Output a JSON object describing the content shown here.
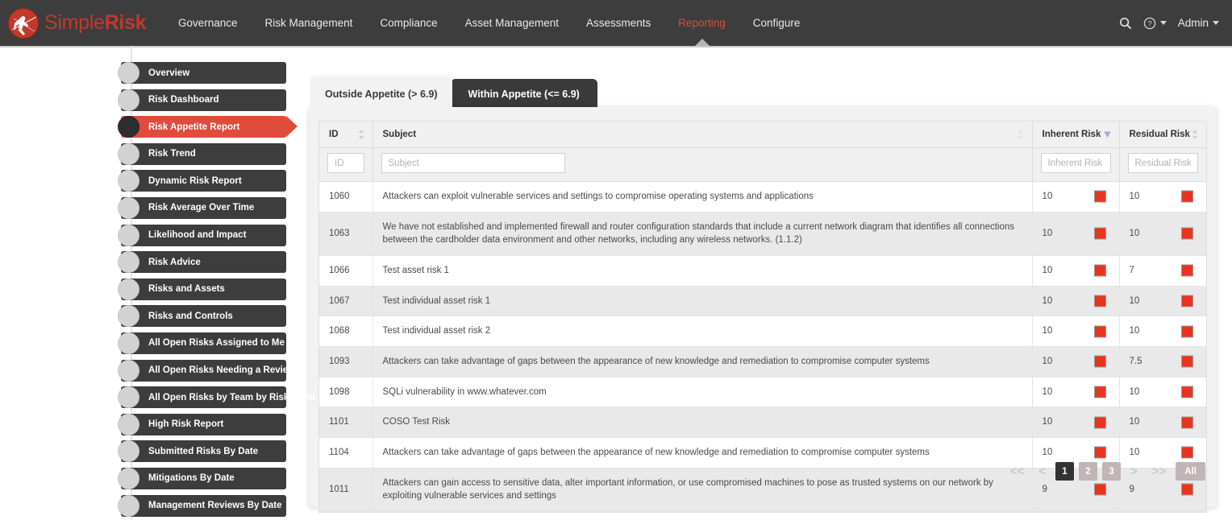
{
  "brand": {
    "part1": "Simple",
    "part2": "Risk",
    "logo_icon": "simplerisk-logo-icon"
  },
  "topnav": {
    "items": [
      {
        "label": "Governance",
        "active": false
      },
      {
        "label": "Risk Management",
        "active": false
      },
      {
        "label": "Compliance",
        "active": false
      },
      {
        "label": "Asset Management",
        "active": false
      },
      {
        "label": "Assessments",
        "active": false
      },
      {
        "label": "Reporting",
        "active": true
      },
      {
        "label": "Configure",
        "active": false
      }
    ],
    "search_icon": "search-icon",
    "help_icon": "help-circle-icon",
    "user_label": "Admin"
  },
  "sidebar": {
    "items": [
      {
        "label": "Overview",
        "active": false
      },
      {
        "label": "Risk Dashboard",
        "active": false
      },
      {
        "label": "Risk Appetite Report",
        "active": true
      },
      {
        "label": "Risk Trend",
        "active": false
      },
      {
        "label": "Dynamic Risk Report",
        "active": false
      },
      {
        "label": "Risk Average Over Time",
        "active": false
      },
      {
        "label": "Likelihood and Impact",
        "active": false
      },
      {
        "label": "Risk Advice",
        "active": false
      },
      {
        "label": "Risks and Assets",
        "active": false
      },
      {
        "label": "Risks and Controls",
        "active": false
      },
      {
        "label": "All Open Risks Assigned to Me",
        "active": false
      },
      {
        "label": "All Open Risks Needing a Review",
        "active": false
      },
      {
        "label": "All Open Risks by Team by Risk Level",
        "active": false
      },
      {
        "label": "High Risk Report",
        "active": false
      },
      {
        "label": "Submitted Risks By Date",
        "active": false
      },
      {
        "label": "Mitigations By Date",
        "active": false
      },
      {
        "label": "Management Reviews By Date",
        "active": false
      }
    ]
  },
  "tabs": [
    {
      "label": "Outside Appetite (> 6.9)",
      "active": true
    },
    {
      "label": "Within Appetite (<= 6.9)",
      "active": false
    }
  ],
  "table": {
    "columns": [
      {
        "label": "ID",
        "sort": "neutral"
      },
      {
        "label": "Subject",
        "sort": "none"
      },
      {
        "label": "Inherent Risk",
        "sort": "desc"
      },
      {
        "label": "Residual Risk",
        "sort": "neutral"
      }
    ],
    "filters": {
      "id_placeholder": "ID",
      "subject_placeholder": "Subject",
      "inherent_placeholder": "Inherent Risk",
      "residual_placeholder": "Residual Risk"
    },
    "rows": [
      {
        "id": "1060",
        "subject": "Attackers can exploit vulnerable services and settings to compromise operating systems and applications",
        "inherent": "10",
        "residual": "10"
      },
      {
        "id": "1063",
        "subject": "We have not established and implemented firewall and router configuration standards that include a current network diagram that identifies all connections between the cardholder data environment and other networks, including any wireless networks. (1.1.2)",
        "inherent": "10",
        "residual": "10"
      },
      {
        "id": "1066",
        "subject": "Test asset risk 1",
        "inherent": "10",
        "residual": "7"
      },
      {
        "id": "1067",
        "subject": "Test individual asset risk 1",
        "inherent": "10",
        "residual": "10"
      },
      {
        "id": "1068",
        "subject": "Test individual asset risk 2",
        "inherent": "10",
        "residual": "10"
      },
      {
        "id": "1093",
        "subject": "Attackers can take advantage of gaps between the appearance of new knowledge and remediation to compromise computer systems",
        "inherent": "10",
        "residual": "7.5"
      },
      {
        "id": "1098",
        "subject": "SQLi vulnerability in www.whatever.com",
        "inherent": "10",
        "residual": "10"
      },
      {
        "id": "1101",
        "subject": "COSO Test Risk",
        "inherent": "10",
        "residual": "10"
      },
      {
        "id": "1104",
        "subject": "Attackers can take advantage of gaps between the appearance of new knowledge and remediation to compromise computer systems",
        "inherent": "10",
        "residual": "10"
      },
      {
        "id": "1011",
        "subject": "Attackers can gain access to sensitive data, alter important information, or use compromised machines to pose as trusted systems on our network by exploiting vulnerable services and settings",
        "inherent": "9",
        "residual": "9"
      }
    ]
  },
  "pagination": {
    "first": "<<",
    "prev": "<",
    "pages": [
      {
        "label": "1",
        "current": true
      },
      {
        "label": "2",
        "current": false
      },
      {
        "label": "3",
        "current": false
      }
    ],
    "next": ">",
    "last": ">>",
    "all": "All"
  },
  "colors": {
    "brand_red": "#c0392b",
    "accent_red": "#e04b3c",
    "risk_chip": "#e8341f",
    "nav_bg": "#3d3d3d",
    "sort_active": "#a9a9d8",
    "pagination": "#c2b5b5"
  }
}
